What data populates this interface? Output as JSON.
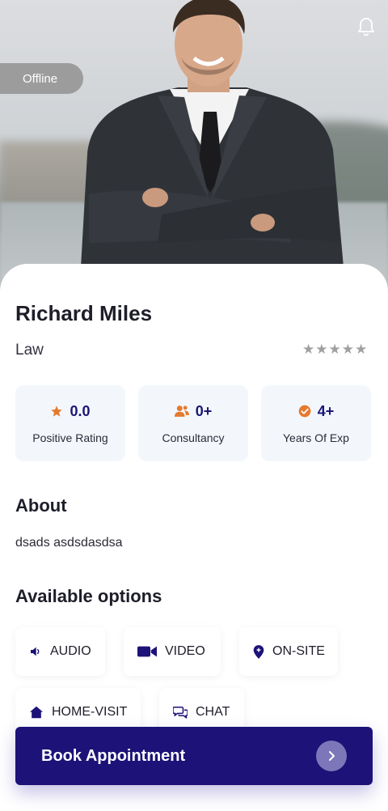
{
  "profile": {
    "status": "Offline",
    "name": "Richard Miles",
    "category": "Law",
    "rating_stars": 0
  },
  "stats": [
    {
      "value": "0.0",
      "label": "Positive Rating",
      "icon": "star-icon"
    },
    {
      "value": "0+",
      "label": "Consultancy",
      "icon": "users-icon"
    },
    {
      "value": "4+",
      "label": "Years Of Exp",
      "icon": "check-badge-icon"
    }
  ],
  "about": {
    "title": "About",
    "text": "dsads asdsdasdsa"
  },
  "options": {
    "title": "Available options",
    "items": [
      {
        "label": "AUDIO",
        "icon": "speaker-icon"
      },
      {
        "label": "VIDEO",
        "icon": "video-camera-icon"
      },
      {
        "label": "ON-SITE",
        "icon": "location-pin-icon"
      },
      {
        "label": "HOME-VISIT",
        "icon": "home-icon"
      },
      {
        "label": "CHAT",
        "icon": "chat-icon"
      }
    ]
  },
  "actions": {
    "book_label": "Book Appointment"
  },
  "colors": {
    "primary": "#1c1278",
    "accent": "#e57a2e",
    "stat_bg": "#f3f7fc",
    "status_pill": "#9c9c9c",
    "star_inactive": "#a0a0a0"
  }
}
